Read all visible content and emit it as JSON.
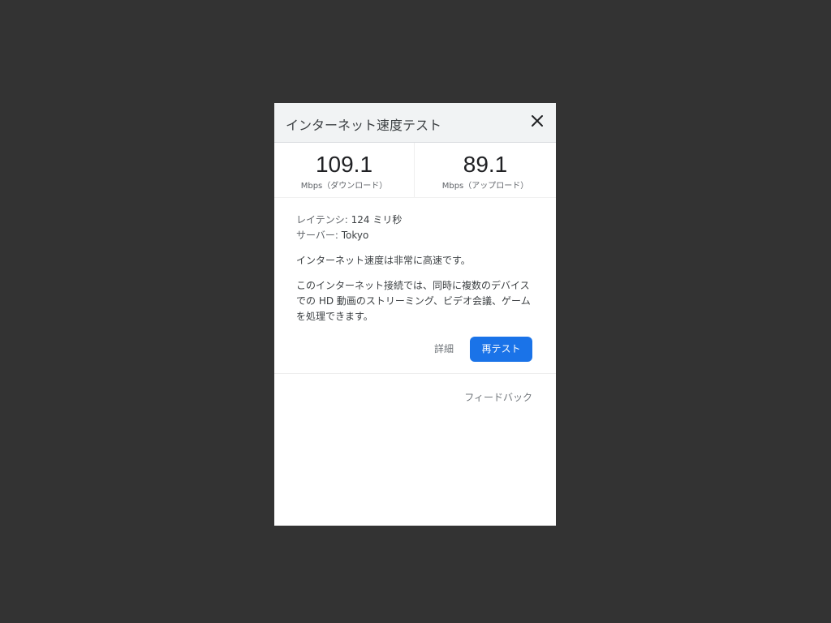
{
  "dialog": {
    "title": "インターネット速度テスト",
    "close_icon": "close-icon"
  },
  "speeds": {
    "download": {
      "value": "109.1",
      "unit": "Mbps（ダウンロード）"
    },
    "upload": {
      "value": "89.1",
      "unit": "Mbps（アップロード）"
    }
  },
  "stats": {
    "latency_label": "レイテンシ:",
    "latency_value": "124 ミリ秒",
    "server_label": "サーバー:",
    "server_value": "Tokyo"
  },
  "summary": "インターネット速度は非常に高速です。",
  "description": "このインターネット接続では、同時に複数のデバイスでの HD 動画のストリーミング、ビデオ会議、ゲームを処理できます。",
  "actions": {
    "detail_label": "詳細",
    "retest_label": "再テスト"
  },
  "footer": {
    "feedback_label": "フィードバック"
  },
  "colors": {
    "primary": "#1a73e8",
    "header_bg": "#f1f3f4",
    "backdrop": "#333333"
  }
}
